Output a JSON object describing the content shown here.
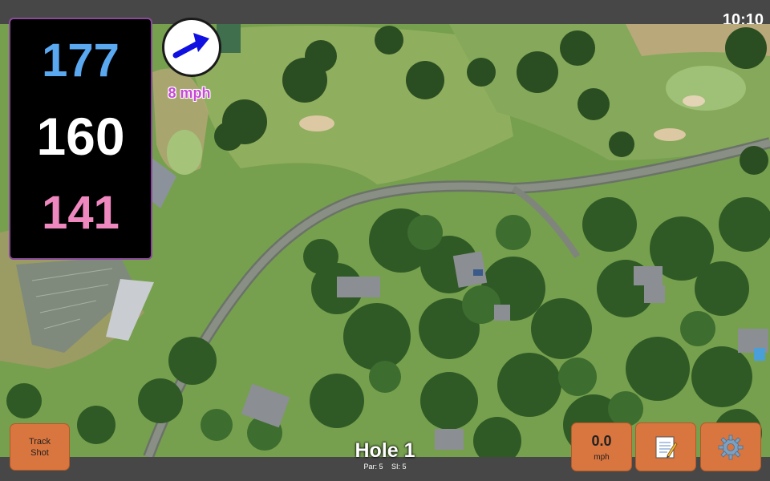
{
  "status_bar": {
    "time": "10:10"
  },
  "distances": {
    "back": "177",
    "middle": "160",
    "front": "141"
  },
  "wind": {
    "speed_label": "8 mph",
    "icon": "wind-direction-arrow-icon"
  },
  "buttons": {
    "track_shot": {
      "line1": "Track",
      "line2": "Shot"
    },
    "wind_speed": {
      "value": "0.0",
      "unit": "mph"
    },
    "notes": {
      "icon": "notepad-icon"
    },
    "settings": {
      "icon": "gear-icon"
    }
  },
  "hole": {
    "title": "Hole 1",
    "par": "Par: 5",
    "si": "SI: 5"
  },
  "colors": {
    "accent": "#d9753e",
    "back_distance": "#5aa8f0",
    "front_distance": "#f088c0",
    "wind_label": "#c848d8",
    "panel_border": "#8a4a9a"
  }
}
